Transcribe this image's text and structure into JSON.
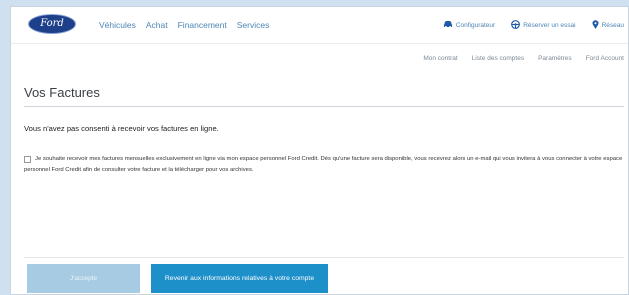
{
  "brand": {
    "logo_text": "Ford"
  },
  "nav": {
    "links": [
      "Véhicules",
      "Achat",
      "Financement",
      "Services"
    ],
    "right": [
      {
        "icon": "car-icon",
        "label": "Configurateur"
      },
      {
        "icon": "steering-wheel-icon",
        "label": "Réserver un essai"
      },
      {
        "icon": "location-pin-icon",
        "label": "Réseau"
      }
    ]
  },
  "subnav": [
    "Mon contrat",
    "Liste des comptes",
    "Paramètres",
    "Ford Account"
  ],
  "page": {
    "title": "Vos Factures",
    "message": "Vous n'avez pas consenti à recevoir vos factures en ligne.",
    "consent_text": "Je souhaite recevoir mes factures mensuelles exclusivement en ligne via mon espace personnel Ford Credit. Dès qu'une facture sera disponible, vous recevrez alors un e-mail qui vous invitera à vous connecter à votre espace personnel Ford Credit afin de consulter votre facture et la télécharger pour vos archives.",
    "consent_checked": false
  },
  "buttons": {
    "accept": "J'accepte",
    "back": "Revenir aux informations relatives à votre compte"
  },
  "colors": {
    "primary": "#1d8fc9",
    "disabled": "#a6cbe2",
    "link": "#4d86b6",
    "background": "#cfe0f1"
  }
}
